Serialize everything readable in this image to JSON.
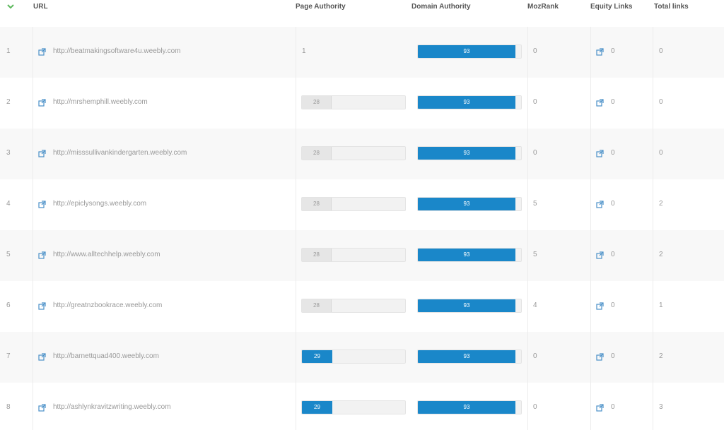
{
  "header": {
    "url": "URL",
    "page_authority": "Page Authority",
    "domain_authority": "Domain Authority",
    "mozrank": "MozRank",
    "equity_links": "Equity Links",
    "total_links": "Total links"
  },
  "colors": {
    "accent_blue": "#1a87c9",
    "sort_icon_green": "#5cb85c",
    "link_icon_blue": "#4a90c8"
  },
  "icons": {
    "sort": "chevron-down-icon",
    "external_link": "external-link-icon"
  },
  "rows": [
    {
      "index": "1",
      "url": "http://beatmakingsoftware4u.weebly.com",
      "page_authority": "1",
      "pa_bar": false,
      "pa_highlight": false,
      "domain_authority": "93",
      "mozrank": "0",
      "equity_links": "0",
      "total_links": "0"
    },
    {
      "index": "2",
      "url": "http://mrshemphill.weebly.com",
      "page_authority": "28",
      "pa_bar": true,
      "pa_highlight": false,
      "domain_authority": "93",
      "mozrank": "0",
      "equity_links": "0",
      "total_links": "0"
    },
    {
      "index": "3",
      "url": "http://misssullivankindergarten.weebly.com",
      "page_authority": "28",
      "pa_bar": true,
      "pa_highlight": false,
      "domain_authority": "93",
      "mozrank": "0",
      "equity_links": "0",
      "total_links": "0"
    },
    {
      "index": "4",
      "url": "http://epiclysongs.weebly.com",
      "page_authority": "28",
      "pa_bar": true,
      "pa_highlight": false,
      "domain_authority": "93",
      "mozrank": "5",
      "equity_links": "0",
      "total_links": "2"
    },
    {
      "index": "5",
      "url": "http://www.alltechhelp.weebly.com",
      "page_authority": "28",
      "pa_bar": true,
      "pa_highlight": false,
      "domain_authority": "93",
      "mozrank": "5",
      "equity_links": "0",
      "total_links": "2"
    },
    {
      "index": "6",
      "url": "http://greatnzbookrace.weebly.com",
      "page_authority": "28",
      "pa_bar": true,
      "pa_highlight": false,
      "domain_authority": "93",
      "mozrank": "4",
      "equity_links": "0",
      "total_links": "1"
    },
    {
      "index": "7",
      "url": "http://barnettquad400.weebly.com",
      "page_authority": "29",
      "pa_bar": true,
      "pa_highlight": true,
      "domain_authority": "93",
      "mozrank": "0",
      "equity_links": "0",
      "total_links": "2"
    },
    {
      "index": "8",
      "url": "http://ashlynkravitzwriting.weebly.com",
      "page_authority": "29",
      "pa_bar": true,
      "pa_highlight": true,
      "domain_authority": "93",
      "mozrank": "0",
      "equity_links": "0",
      "total_links": "3"
    }
  ]
}
